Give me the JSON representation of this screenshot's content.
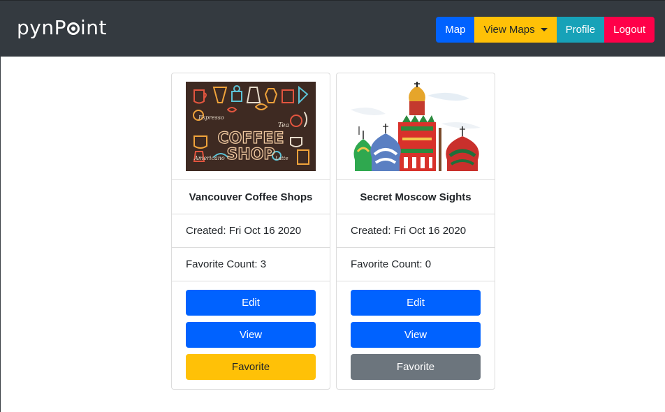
{
  "navbar": {
    "brand": "pynPoint",
    "buttons": {
      "map": "Map",
      "view_maps": "View Maps",
      "profile": "Profile",
      "logout": "Logout"
    }
  },
  "colors": {
    "navbar_bg": "#343a40",
    "primary": "#0062ff",
    "warning": "#ffc107",
    "info": "#17a2b8",
    "danger": "#ff0049",
    "secondary": "#6c757d"
  },
  "cards": [
    {
      "image": "coffee-shop-illustration",
      "image_text": [
        "COFFEE",
        "SHOP",
        "Espresso",
        "Tea",
        "Americano",
        "Latte"
      ],
      "title": "Vancouver Coffee Shops",
      "created": "Created: Fri Oct 16 2020",
      "favorite_count": "Favorite Count: 3",
      "edit": "Edit",
      "view": "View",
      "favorite": "Favorite",
      "favorited": true
    },
    {
      "image": "moscow-cathedral-watercolor",
      "title": "Secret Moscow Sights",
      "created": "Created: Fri Oct 16 2020",
      "favorite_count": "Favorite Count: 0",
      "edit": "Edit",
      "view": "View",
      "favorite": "Favorite",
      "favorited": false
    }
  ]
}
